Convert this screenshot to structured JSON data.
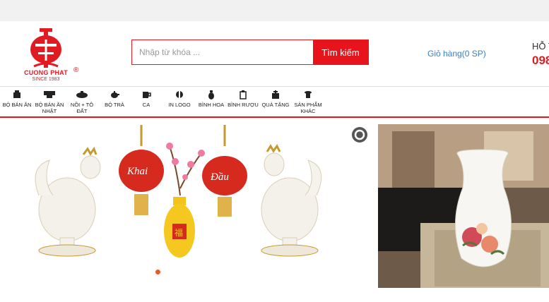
{
  "brand": {
    "name": "CUONG PHAT",
    "since": "SINCE 1983",
    "reg": "®",
    "color": "#e11b22"
  },
  "search": {
    "placeholder": "Nhập từ khóa ...",
    "button_label": "Tìm kiếm"
  },
  "cart": {
    "label": "Giỏ hàng(0 SP)"
  },
  "hotline": {
    "title": "HỖ T",
    "number": "098"
  },
  "nav": {
    "items": [
      {
        "label": "BỘ BÁN ĂN",
        "icon": "tableware-set-icon"
      },
      {
        "label": "BỘ BÁN ĂN NHẬT",
        "icon": "japanese-bowl-icon"
      },
      {
        "label": "NỒI + TÔ ĐẤT",
        "icon": "clay-pot-icon"
      },
      {
        "label": "BỘ TRÀ",
        "icon": "teapot-icon"
      },
      {
        "label": "CA",
        "icon": "mug-icon"
      },
      {
        "label": "IN LOGO",
        "icon": "logo-print-icon"
      },
      {
        "label": "BÌNH HOA",
        "icon": "flower-vase-icon"
      },
      {
        "label": "BÌNH RƯỢU",
        "icon": "wine-jar-icon"
      },
      {
        "label": "QUÀ TẶNG",
        "icon": "gift-icon"
      },
      {
        "label": "SẢN PHẨM KHÁC",
        "icon": "other-products-icon"
      }
    ]
  },
  "banner": {
    "lantern_left_text": "Khai",
    "lantern_right_text": "Đầu",
    "vase_text": "福"
  }
}
